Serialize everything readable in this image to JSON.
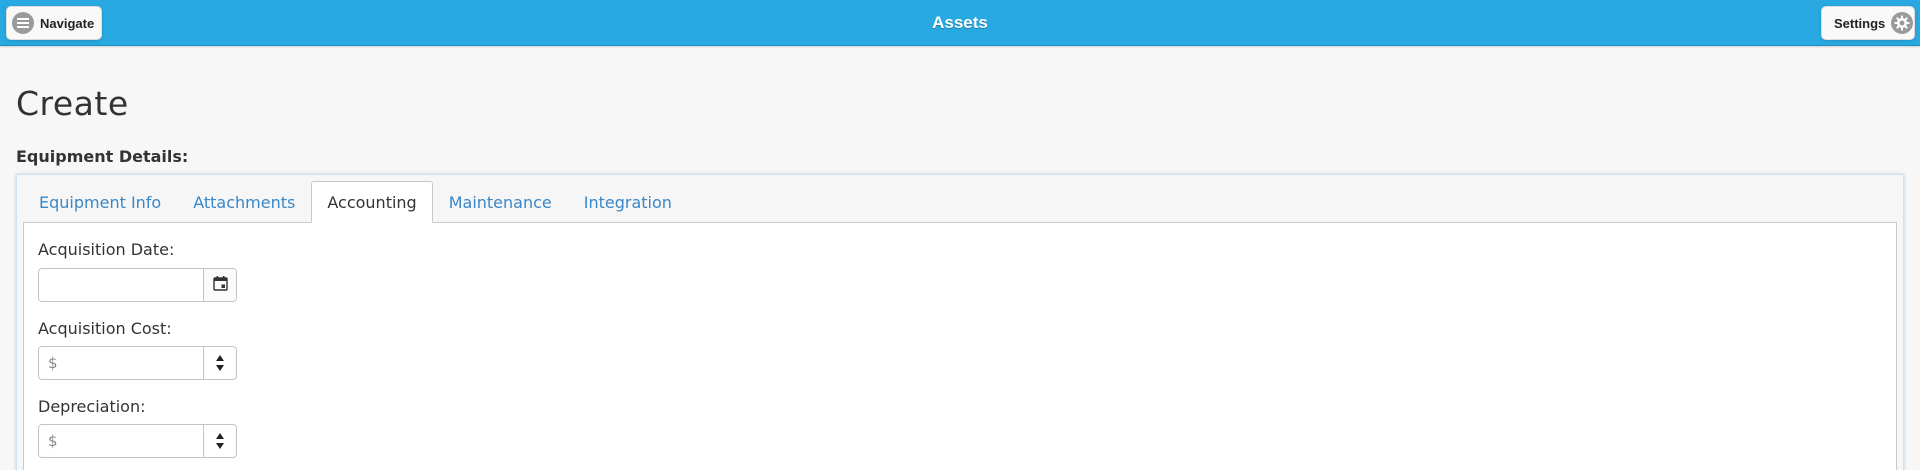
{
  "header": {
    "title": "Assets",
    "navigate_label": "Navigate",
    "settings_label": "Settings",
    "background_color": "#29a9e1"
  },
  "page": {
    "title": "Create",
    "section_label": "Equipment Details:"
  },
  "tabs": [
    {
      "label": "Equipment Info",
      "active": false
    },
    {
      "label": "Attachments",
      "active": false
    },
    {
      "label": "Accounting",
      "active": true
    },
    {
      "label": "Maintenance",
      "active": false
    },
    {
      "label": "Integration",
      "active": false
    }
  ],
  "accounting": {
    "acquisition_date": {
      "label": "Acquisition Date:",
      "value": "",
      "placeholder": ""
    },
    "acquisition_cost": {
      "label": "Acquisition Cost:",
      "value": "",
      "placeholder": "$"
    },
    "depreciation": {
      "label": "Depreciation:",
      "value": "",
      "placeholder": "$"
    }
  },
  "icons": {
    "navigate": "menu-icon",
    "settings": "gear-icon",
    "date_picker": "calendar-icon",
    "spinner_up": "arrow-up-icon",
    "spinner_down": "arrow-down-icon"
  },
  "colors": {
    "link": "#3a87c8",
    "text": "#333333",
    "icon_gray": "#9a9a9a"
  }
}
